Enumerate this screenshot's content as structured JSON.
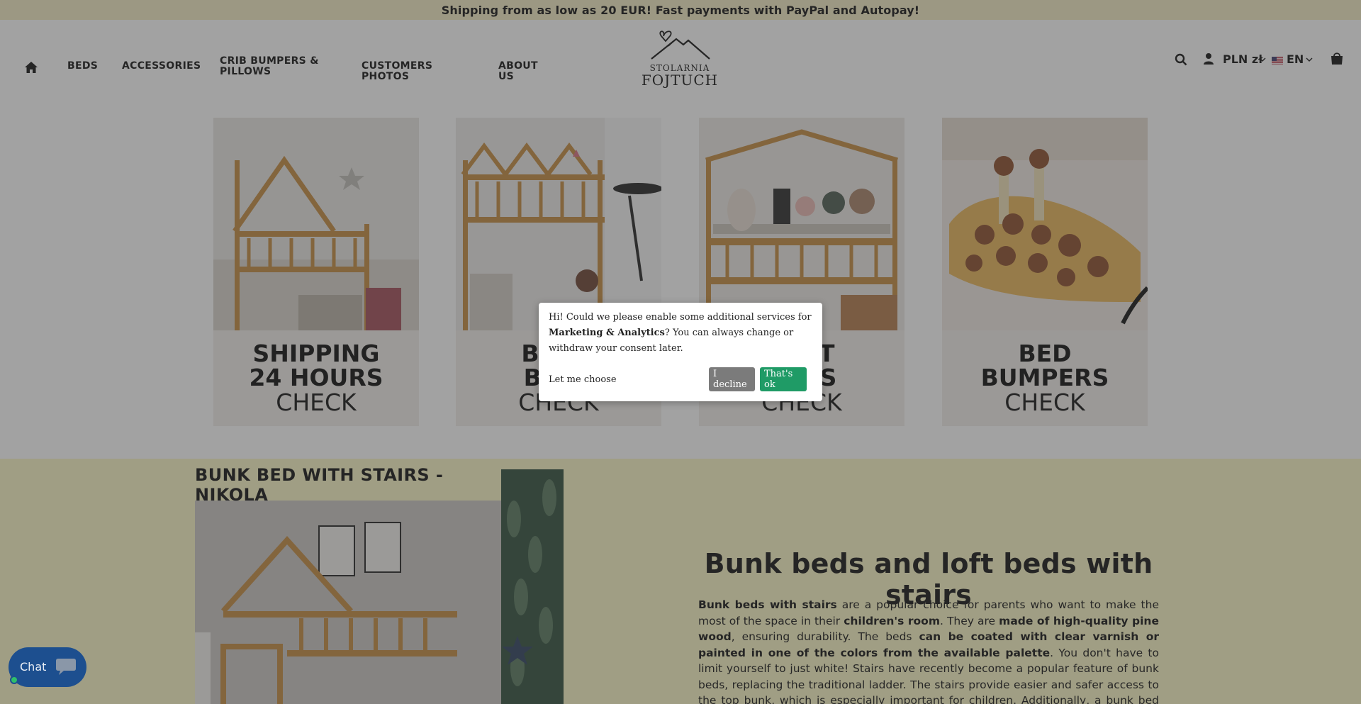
{
  "announcement": "Shipping from as low as 20 EUR! Fast payments with PayPal and Autopay!",
  "nav": {
    "items": [
      {
        "label": "BEDS"
      },
      {
        "label": "ACCESSORIES"
      },
      {
        "label": "CRIB BUMPERS & PILLOWS"
      },
      {
        "label": "CUSTOMERS PHOTOS"
      },
      {
        "label": "ABOUT US"
      }
    ]
  },
  "logo": {
    "line1": "STOLARNIA",
    "line2": "FOJTUCH"
  },
  "header_right": {
    "currency": "PLN zł",
    "language": "EN"
  },
  "cards": [
    {
      "line1": "SHIPPING",
      "line2": "24 HOURS",
      "check": "CHECK"
    },
    {
      "line1": "BUNK",
      "line2": "BEDS",
      "check": "CHECK"
    },
    {
      "line1": "LOFT",
      "line2": "BEDS",
      "check": "CHECK"
    },
    {
      "line1": "BED",
      "line2": "BUMPERS",
      "check": "CHECK"
    }
  ],
  "feature": {
    "product_title": "BUNK BED WITH STAIRS - NIKOLA",
    "heading": "Bunk beds and loft beds with stairs",
    "p1_b1": "Bunk beds with stairs",
    "p1_t1": " are a popular choice for parents who want to make the most of the space in their ",
    "p1_b2": "children's room",
    "p1_t2": ". They are ",
    "p1_b3": "made of high-quality pine wood",
    "p1_t3": ", ensuring durability. The beds ",
    "p1_b4": "can be coated with clear varnish or painted in one of the colors from the available palette",
    "p1_t4": ". You don't have to limit yourself to just white! Stairs have recently become a popular feature of bunk beds, replacing the traditional ladder. The stairs provide easier and safer access to the top bunk, which is especially important for children. Additionally, a bunk bed with stairs has a much more appealing appearance."
  },
  "consent": {
    "text1": "Hi! Could we please enable some additional services for ",
    "text_bold": "Marketing & Analytics",
    "text2": "? You can always change or withdraw your consent later.",
    "let_me_choose": "Let me choose",
    "decline": "I decline",
    "accept": "That's ok"
  },
  "chat": {
    "label": "Chat"
  },
  "colors": {
    "announcement_bg": "#f3ecc4",
    "feature_bg": "#fbf7c6",
    "accept": "#1f9b66",
    "decline": "#7b7b7b",
    "chat": "#1d4f8f"
  }
}
